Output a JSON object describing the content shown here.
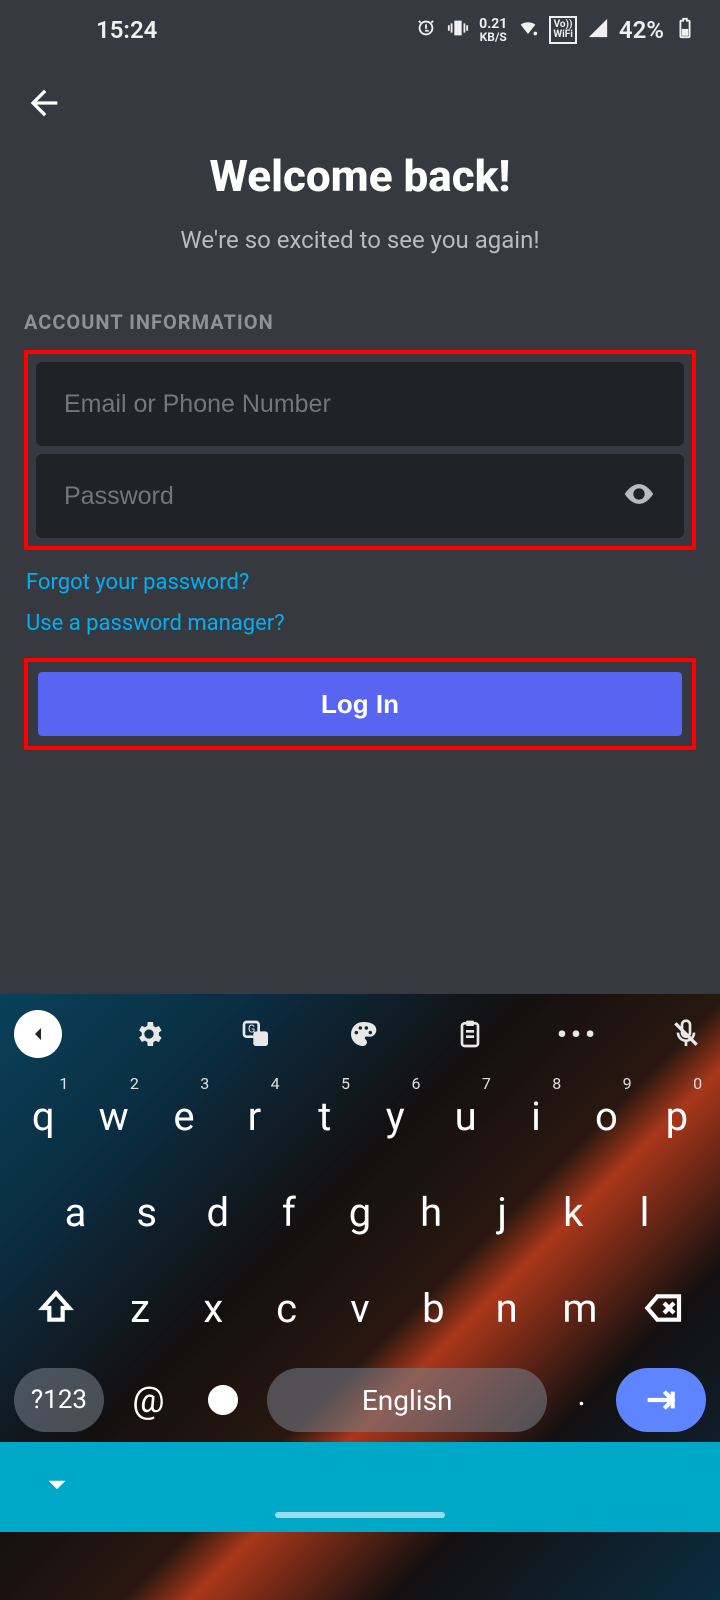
{
  "status": {
    "time": "15:24",
    "net_speed_value": "0.21",
    "net_speed_unit": "KB/S",
    "vowifi_top": "Vo))",
    "vowifi_bottom": "WiFi",
    "battery_pct": "42%"
  },
  "nav": {
    "back": "Back"
  },
  "hero": {
    "title": "Welcome back!",
    "subtitle": "We're so excited to see you again!"
  },
  "form": {
    "section_label": "ACCOUNT INFORMATION",
    "email_placeholder": "Email or Phone Number",
    "email_value": "",
    "password_placeholder": "Password",
    "password_value": "",
    "forgot_link": "Forgot your password?",
    "pm_link": "Use a password manager?",
    "login_label": "Log In"
  },
  "keyboard": {
    "row1": [
      {
        "k": "q",
        "n": "1"
      },
      {
        "k": "w",
        "n": "2"
      },
      {
        "k": "e",
        "n": "3"
      },
      {
        "k": "r",
        "n": "4"
      },
      {
        "k": "t",
        "n": "5"
      },
      {
        "k": "y",
        "n": "6"
      },
      {
        "k": "u",
        "n": "7"
      },
      {
        "k": "i",
        "n": "8"
      },
      {
        "k": "o",
        "n": "9"
      },
      {
        "k": "p",
        "n": "0"
      }
    ],
    "row2": [
      "a",
      "s",
      "d",
      "f",
      "g",
      "h",
      "j",
      "k",
      "l"
    ],
    "row3": [
      "z",
      "x",
      "c",
      "v",
      "b",
      "n",
      "m"
    ],
    "sym_label": "?123",
    "at_label": "@",
    "space_label": "English",
    "period_label": "."
  },
  "colors": {
    "accent": "#5865f2",
    "link": "#00aff4",
    "input_bg": "#202225",
    "bg": "#36393f",
    "highlight": "#ff0000"
  }
}
